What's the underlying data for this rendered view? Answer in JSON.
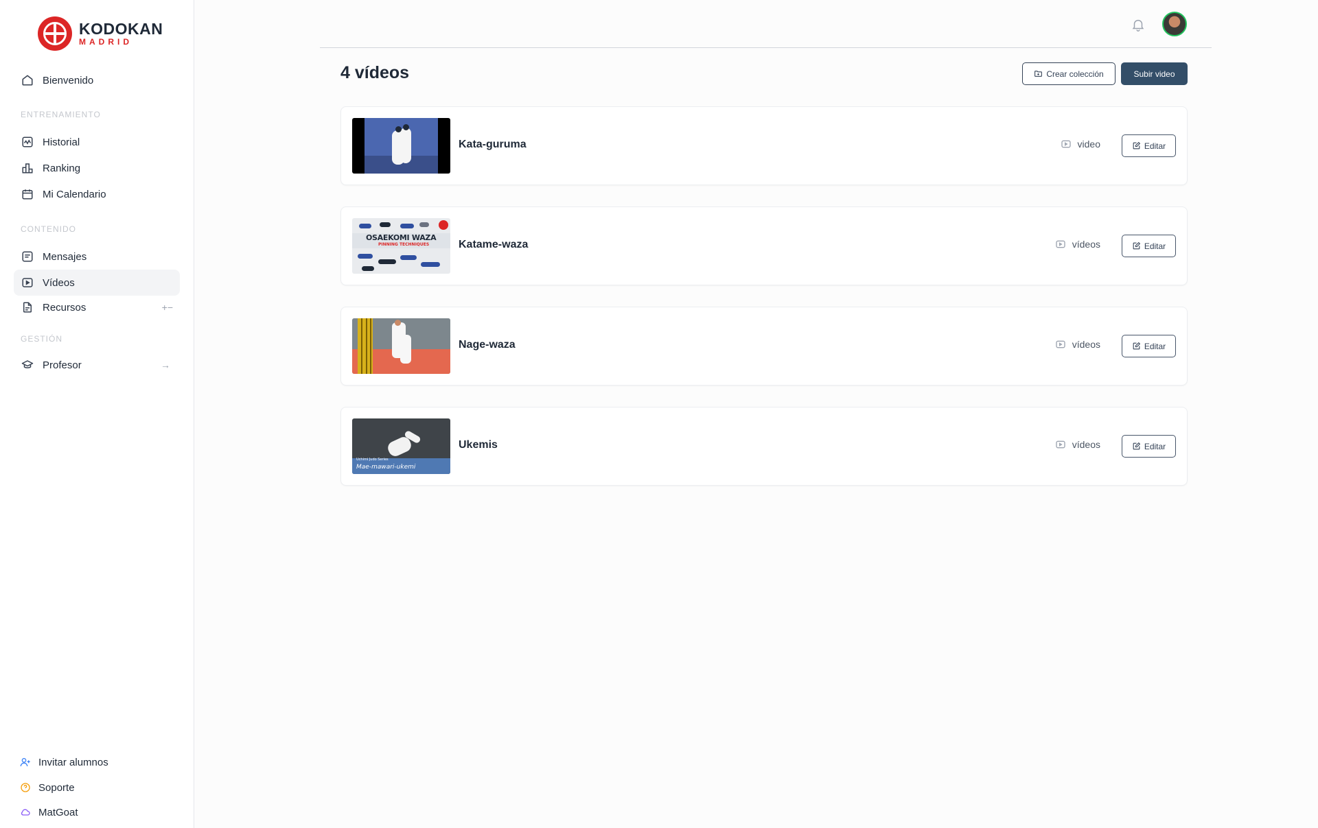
{
  "brand": {
    "name": "KODOKAN",
    "sub": "MADRID",
    "accent": "#dc2626"
  },
  "sidebar": {
    "welcome": "Bienvenido",
    "sections": {
      "training": "ENTRENAMIENTO",
      "content": "CONTENIDO",
      "management": "GESTIÓN"
    },
    "items": [
      {
        "label": "Historial",
        "icon": "activity-icon"
      },
      {
        "label": "Ranking",
        "icon": "ranking-icon"
      },
      {
        "label": "Mi Calendario",
        "icon": "calendar-icon"
      },
      {
        "label": "Mensajes",
        "icon": "message-icon"
      },
      {
        "label": "Vídeos",
        "icon": "video-icon",
        "active": true
      },
      {
        "label": "Recursos",
        "icon": "file-icon",
        "trail": "+−"
      },
      {
        "label": "Profesor",
        "icon": "graduation-cap-icon",
        "trail": "→"
      }
    ],
    "footer": [
      {
        "label": "Invitar alumnos",
        "icon": "user-plus-icon",
        "color": "#3b82f6"
      },
      {
        "label": "Soporte",
        "icon": "help-circle-icon",
        "color": "#f59e0b"
      },
      {
        "label": "MatGoat",
        "icon": "cloud-icon",
        "color": "#8b5cf6"
      }
    ]
  },
  "main": {
    "title": "4 vídeos",
    "create_collection": "Crear colección",
    "upload_video": "Subir video",
    "edit_label": "Editar",
    "collections": [
      {
        "title": "Kata-guruma",
        "count_label": "video"
      },
      {
        "title": "Katame-waza",
        "count_label": "vídeos",
        "thumb_title": "OSAEKOMI WAZA",
        "thumb_subtitle": "PINNING TECHNIQUES"
      },
      {
        "title": "Nage-waza",
        "count_label": "vídeos"
      },
      {
        "title": "Ukemis",
        "count_label": "vídeos",
        "thumb_caption_small": "Uchimi Judo Series",
        "thumb_caption": "Mae-mawari-ukemi"
      }
    ]
  }
}
